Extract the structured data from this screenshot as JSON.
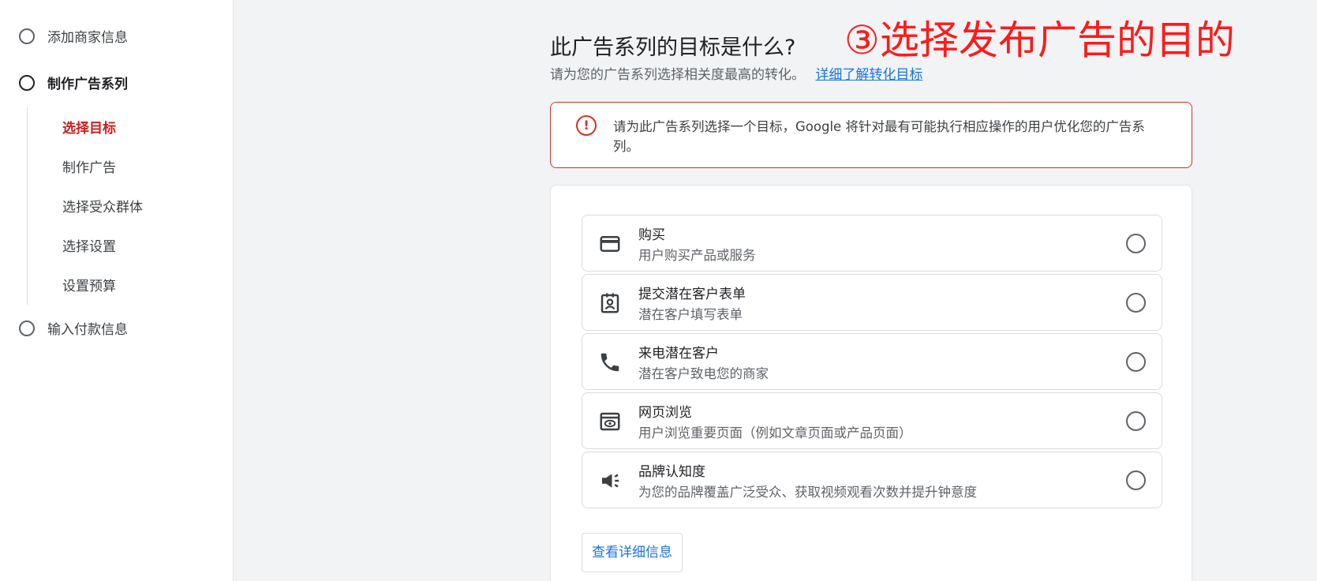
{
  "sidebar": {
    "steps": [
      {
        "label": "添加商家信息"
      },
      {
        "label": "制作广告系列"
      },
      {
        "label": "输入付款信息"
      }
    ],
    "substeps": [
      {
        "label": "选择目标"
      },
      {
        "label": "制作广告"
      },
      {
        "label": "选择受众群体"
      },
      {
        "label": "选择设置"
      },
      {
        "label": "设置预算"
      }
    ]
  },
  "main": {
    "heading": "此广告系列的目标是什么?",
    "annotation": "③选择发布广告的目的",
    "subtitle": "请为您的广告系列选择相关度最高的转化。",
    "subtitle_link": "详细了解转化目标",
    "error": {
      "icon": "!",
      "text": "请为此广告系列选择一个目标，Google 将针对最有可能执行相应操作的用户优化您的广告系列。"
    },
    "options": [
      {
        "icon": "credit-card-icon",
        "title": "购买",
        "desc": "用户购买产品或服务"
      },
      {
        "icon": "contact-form-icon",
        "title": "提交潜在客户表单",
        "desc": "潜在客户填写表单"
      },
      {
        "icon": "phone-icon",
        "title": "来电潜在客户",
        "desc": "潜在客户致电您的商家"
      },
      {
        "icon": "webpage-view-icon",
        "title": "网页浏览",
        "desc": "用户浏览重要页面（例如文章页面或产品页面）"
      },
      {
        "icon": "megaphone-icon",
        "title": "品牌认知度",
        "desc": "为您的品牌覆盖广泛受众、获取视频观看次数并提升钟意度"
      }
    ],
    "details_button": "查看详细信息"
  },
  "colors": {
    "accent_red": "#c5221f",
    "error_border": "#d93025",
    "link_blue": "#1a73e8",
    "annotation_red": "#ff1a1a"
  }
}
